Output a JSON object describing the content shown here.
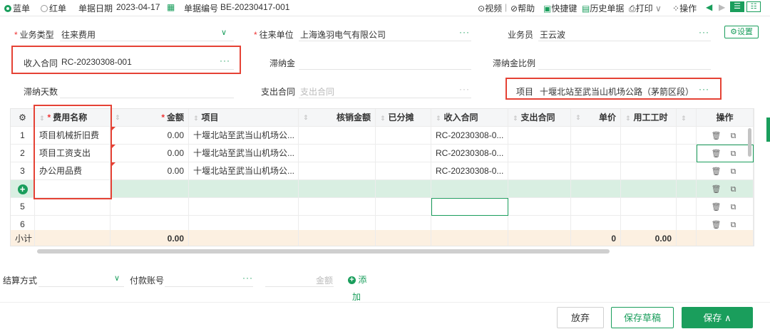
{
  "topbar": {
    "blue_label": "蓝单",
    "red_label": "红单",
    "date_label": "单据日期",
    "date_value": "2023-04-17",
    "no_label": "单据编号",
    "no_value": "BE-20230417-001",
    "video": "视频",
    "help": "帮助",
    "shortcut": "快捷键",
    "history": "历史单据",
    "print": "打印",
    "ops": "操作"
  },
  "form": {
    "biz_type_label": "业务类型",
    "biz_type_value": "往来费用",
    "partner_label": "往来单位",
    "partner_value": "上海逸羽电气有限公司",
    "staff_label": "业务员",
    "staff_value": "王云波",
    "settings": "设置",
    "income_contract_label": "收入合同",
    "income_contract_value": "RC-20230308-001",
    "late_fee_label": "滞纳金",
    "late_fee_ratio_label": "滞纳金比例",
    "late_days_label": "滞纳天数",
    "expense_contract_label": "支出合同",
    "expense_contract_placeholder": "支出合同",
    "project_label": "项目",
    "project_value": "十堰北站至武当山机场公路（茅箭区段）PP..."
  },
  "grid": {
    "headers": {
      "fee_name": "费用名称",
      "amount": "金额",
      "project": "项目",
      "writeoff": "核销金额",
      "allocated": "已分摊",
      "income_contract": "收入合同",
      "expense_contract": "支出合同",
      "unit_price": "单价",
      "hours": "用工工时",
      "ops": "操作"
    },
    "rows": [
      {
        "no": "1",
        "fee": "项目机械折旧费",
        "amount": "0.00",
        "project": "十堰北站至武当山机场公...",
        "contract": "RC-20230308-0..."
      },
      {
        "no": "2",
        "fee": "项目工资支出",
        "amount": "0.00",
        "project": "十堰北站至武当山机场公...",
        "contract": "RC-20230308-0..."
      },
      {
        "no": "3",
        "fee": "办公用品费",
        "amount": "0.00",
        "project": "十堰北站至武当山机场公...",
        "contract": "RC-20230308-0..."
      }
    ],
    "row5": "5",
    "row6": "6",
    "subtotal_label": "小计",
    "subtotal_amount": "0.00",
    "subtotal_price": "0",
    "subtotal_hours": "0.00"
  },
  "footer": {
    "settle_label": "结算方式",
    "account_label": "付款账号",
    "amount_placeholder": "金额",
    "add_label": "添",
    "add_label2": "加",
    "discard": "放弃",
    "save_draft": "保存草稿",
    "save": "保存"
  },
  "colors": {
    "accent": "#1a9e5c",
    "highlight": "#e54235"
  }
}
